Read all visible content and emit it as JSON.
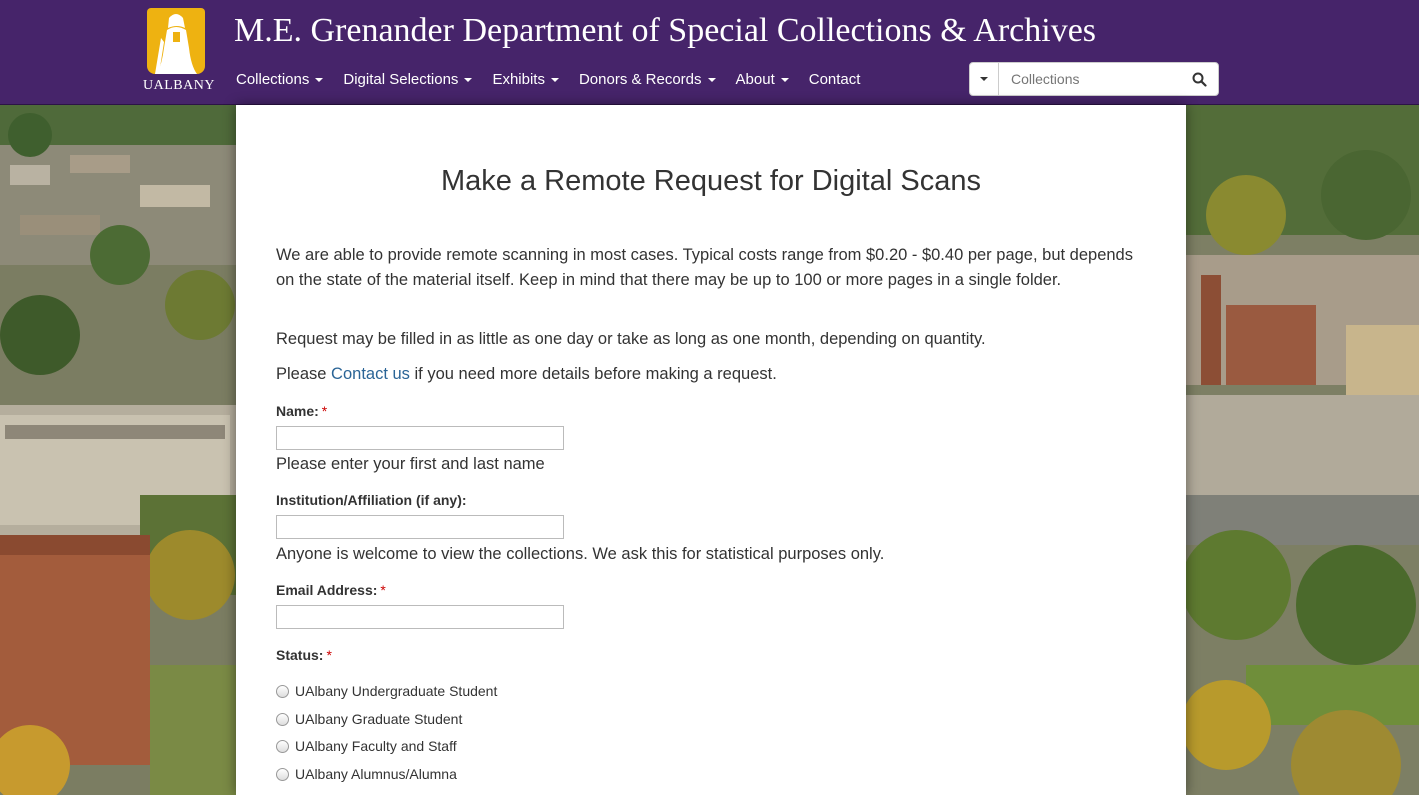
{
  "header": {
    "logo_wordmark": "UALBANY",
    "title": "M.E. Grenander Department of Special Collections & Archives",
    "brand_purple": "#46246a",
    "brand_gold": "#eeb211"
  },
  "nav": {
    "items": [
      {
        "label": "Collections",
        "has_dropdown": true
      },
      {
        "label": "Digital Selections",
        "has_dropdown": true
      },
      {
        "label": "Exhibits",
        "has_dropdown": true
      },
      {
        "label": "Donors & Records",
        "has_dropdown": true
      },
      {
        "label": "About",
        "has_dropdown": true
      },
      {
        "label": "Contact",
        "has_dropdown": false
      }
    ]
  },
  "search": {
    "placeholder": "Collections",
    "icon": "search-icon"
  },
  "main": {
    "title": "Make a Remote Request for Digital Scans",
    "intro": "We are able to provide remote scanning in most cases. Typical costs range from $0.20 - $0.40 per page, but depends on the state of the material itself. Keep in mind that there may be up to 100 or more pages in a single folder.",
    "timing": "Request may be filled in as little as one day or take as long as one month, depending on quantity.",
    "contact_prefix": "Please ",
    "contact_link": "Contact us",
    "contact_suffix": " if you need more details before making a request."
  },
  "form": {
    "required_mark": "*",
    "name_label": "Name:",
    "name_value": "",
    "name_help": "Please enter your first and last name",
    "institution_label": "Institution/Affiliation (if any):",
    "institution_value": "",
    "institution_help": "Anyone is welcome to view the collections. We ask this for statistical purposes only.",
    "email_label": "Email Address:",
    "email_value": "",
    "status_label": "Status:",
    "status_options": [
      "UAlbany Undergraduate Student",
      "UAlbany Graduate Student",
      "UAlbany Faculty and Staff",
      "UAlbany Alumnus/Alumna"
    ]
  }
}
